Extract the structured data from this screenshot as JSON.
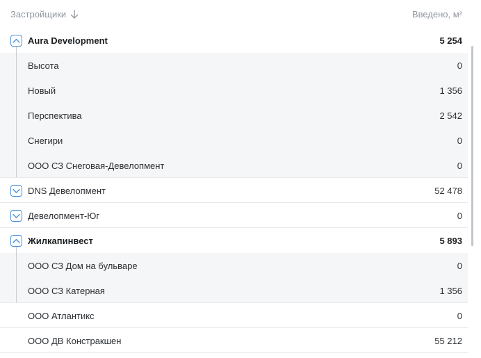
{
  "header": {
    "developers_label": "Застройщики",
    "commissioned_label": "Введено, м²"
  },
  "rows": [
    {
      "label": "Aura Development",
      "value": "5 254"
    },
    {
      "label": "Высота",
      "value": "0"
    },
    {
      "label": "Новый",
      "value": "1 356"
    },
    {
      "label": "Перспектива",
      "value": "2 542"
    },
    {
      "label": "Снегири",
      "value": "0"
    },
    {
      "label": "ООО СЗ Снеговая-Девелопмент",
      "value": "0"
    },
    {
      "label": "DNS Девелопмент",
      "value": "52 478"
    },
    {
      "label": "Девелопмент-Юг",
      "value": "0"
    },
    {
      "label": "Жилкапинвест",
      "value": "5 893"
    },
    {
      "label": "ООО СЗ Дом на бульваре",
      "value": "0"
    },
    {
      "label": "ООО СЗ Катерная",
      "value": "1 356"
    },
    {
      "label": "ООО Атлантикс",
      "value": "0"
    },
    {
      "label": "ООО ДВ Констракшен",
      "value": "55 212"
    }
  ]
}
